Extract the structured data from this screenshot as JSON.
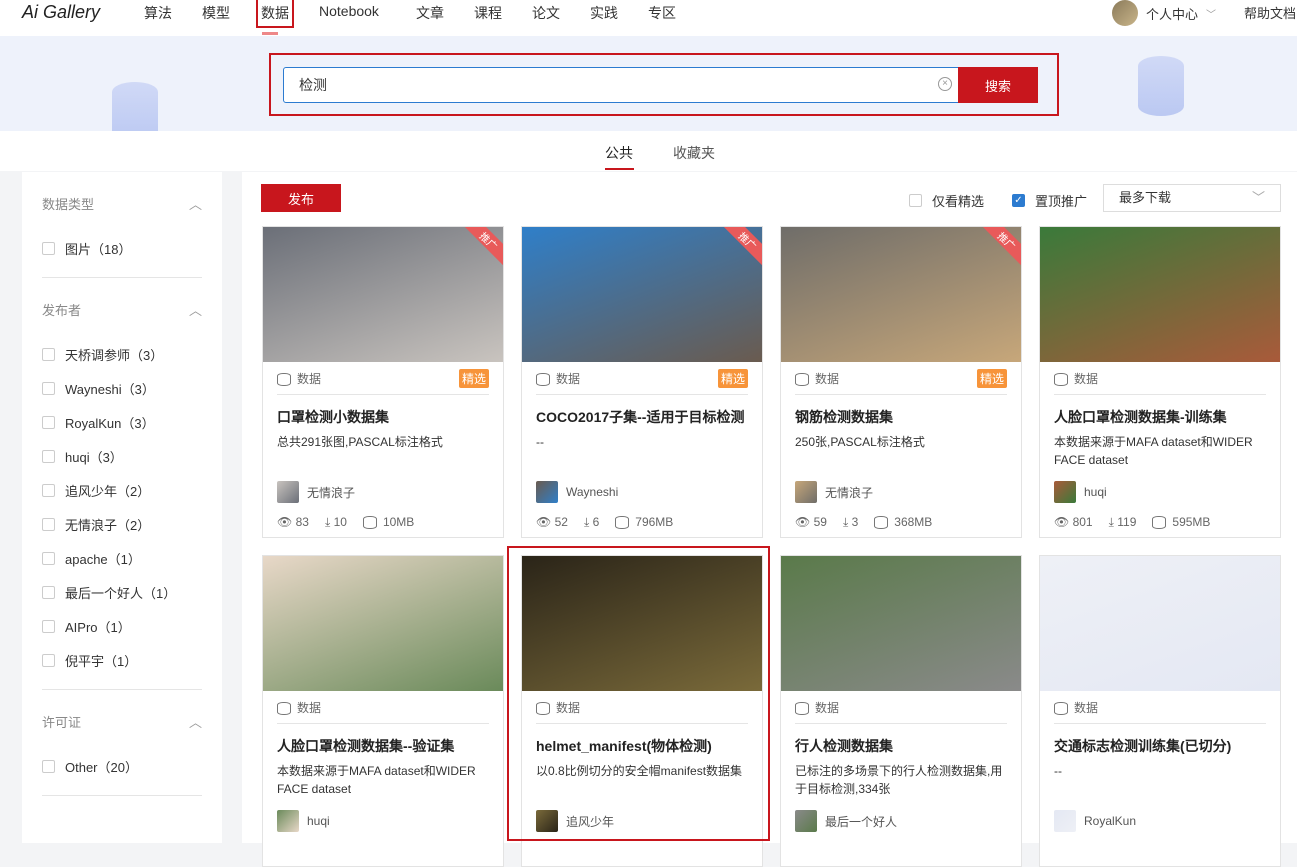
{
  "nav": {
    "logo": "Ai Gallery",
    "items": [
      "算法",
      "模型",
      "数据",
      "Notebook",
      "文章",
      "课程",
      "论文",
      "实践",
      "专区"
    ],
    "user": "个人中心",
    "help": "帮助文档"
  },
  "search": {
    "value": "检测",
    "button": "搜索"
  },
  "tabs": [
    "公共",
    "收藏夹"
  ],
  "sidebar": {
    "groups": [
      {
        "title": "数据类型",
        "items": [
          "图片（18）"
        ]
      },
      {
        "title": "发布者",
        "items": [
          "天桥调参师（3）",
          "Wayneshi（3）",
          "RoyalKun（3）",
          "huqi（3）",
          "追风少年（2）",
          "无情浪子（2）",
          "apache（1）",
          "最后一个好人（1）",
          "AIPro（1）",
          "倪平宇（1）"
        ]
      },
      {
        "title": "许可证",
        "items": [
          "Other（20）"
        ]
      }
    ]
  },
  "toolbar": {
    "publish": "发布",
    "only_featured": "仅看精选",
    "pinned": "置顶推广",
    "sort": "最多下载"
  },
  "card_type": "数据",
  "featured_label": "精选",
  "promo_label": "推广",
  "cards": [
    {
      "title": "口罩检测小数据集",
      "desc": "总共291张图,PASCAL标注格式",
      "author": "无情浪子",
      "views": "83",
      "downloads": "10",
      "size": "10MB",
      "featured": true,
      "promo": true,
      "c1": "#6b6f78",
      "c2": "#c9c4bf"
    },
    {
      "title": "COCO2017子集--适用于目标检测",
      "desc": "--",
      "author": "Wayneshi",
      "views": "52",
      "downloads": "6",
      "size": "796MB",
      "featured": true,
      "promo": true,
      "c1": "#2f7fc9",
      "c2": "#6a5b4f"
    },
    {
      "title": "钢筋检测数据集",
      "desc": "250张,PASCAL标注格式",
      "author": "无情浪子",
      "views": "59",
      "downloads": "3",
      "size": "368MB",
      "featured": true,
      "promo": true,
      "c1": "#6f6d69",
      "c2": "#c7a77a"
    },
    {
      "title": "人脸口罩检测数据集-训练集",
      "desc": "本数据来源于MAFA dataset和WIDER FACE dataset",
      "author": "huqi",
      "views": "801",
      "downloads": "119",
      "size": "595MB",
      "featured": false,
      "promo": false,
      "c1": "#3a7a3a",
      "c2": "#a95a3a"
    },
    {
      "title": "人脸口罩检测数据集--验证集",
      "desc": "本数据来源于MAFA dataset和WIDER FACE dataset",
      "author": "huqi",
      "featured": false,
      "promo": false,
      "c1": "#e8d8c8",
      "c2": "#6a8a5a"
    },
    {
      "title": "helmet_manifest(物体检测)",
      "desc": "以0.8比例切分的安全帽manifest数据集",
      "author": "追风少年",
      "featured": false,
      "promo": false,
      "c1": "#2a2418",
      "c2": "#7a6a3a"
    },
    {
      "title": "行人检测数据集",
      "desc": "已标注的多场景下的行人检测数据集,用于目标检测,334张",
      "author": "最后一个好人",
      "featured": false,
      "promo": false,
      "c1": "#5a7a4a",
      "c2": "#8a8a8a"
    },
    {
      "title": "交通标志检测训练集(已切分)",
      "desc": "--",
      "author": "RoyalKun",
      "featured": false,
      "promo": false,
      "c1": "#eef0f6",
      "c2": "#e4e8f3"
    }
  ]
}
